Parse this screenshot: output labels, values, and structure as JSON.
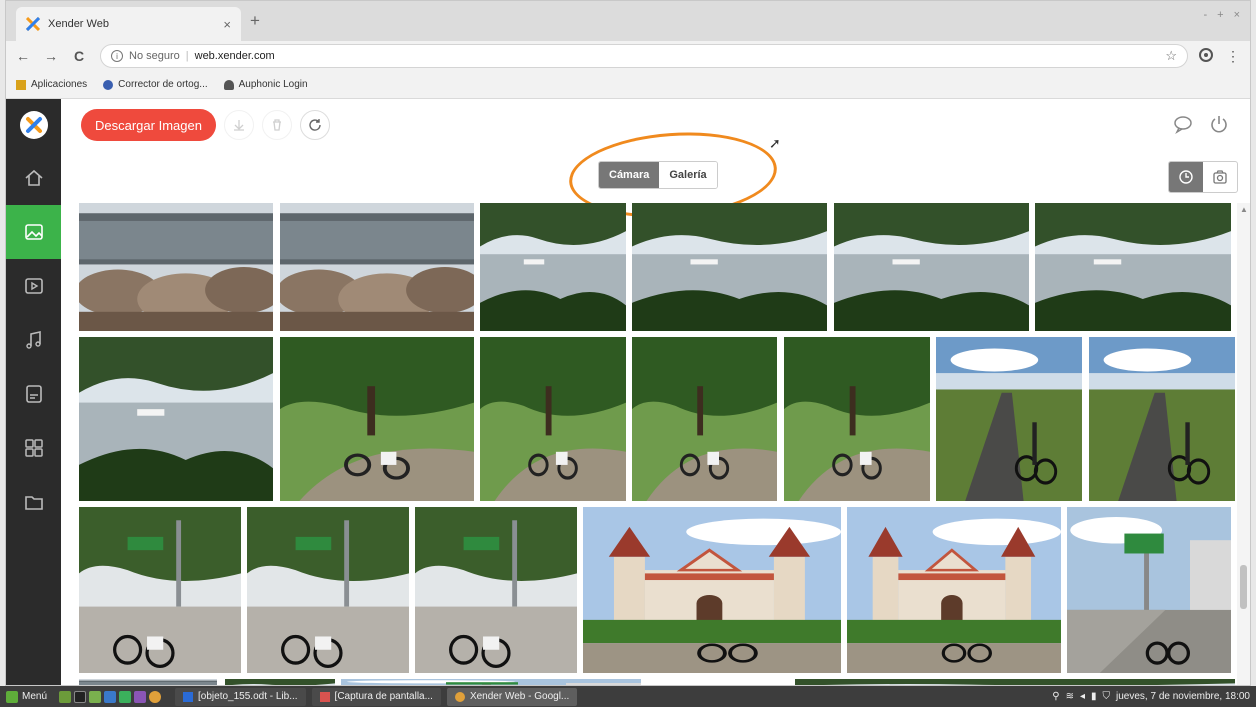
{
  "browser": {
    "tab_title": "Xender Web",
    "tab_close": "×",
    "new_tab": "+",
    "window_controls": [
      "-",
      "+",
      "×"
    ],
    "nav": {
      "back": "←",
      "forward": "→",
      "reload": "C"
    },
    "omnibox": {
      "security": "No seguro",
      "separator": "|",
      "url": "web.xender.com",
      "star": "☆"
    },
    "menu": "⋮",
    "bookmarks": [
      {
        "label": "Aplicaciones",
        "icon": "apps-grid-icon",
        "color": "#d9a21b"
      },
      {
        "label": "Corrector de ortog...",
        "icon": "spellcheck-icon",
        "color": "#3a5fb0"
      },
      {
        "label": "Auphonic Login",
        "icon": "auphonic-icon",
        "color": "#555555"
      }
    ]
  },
  "app": {
    "download_label": "Descargar Imagen",
    "tabs": [
      {
        "label": "Cámara",
        "active": true
      },
      {
        "label": "Galería",
        "active": false
      }
    ],
    "sidebar": [
      {
        "icon": "home-icon",
        "active": false
      },
      {
        "icon": "image-icon",
        "active": true
      },
      {
        "icon": "video-icon",
        "active": false
      },
      {
        "icon": "music-icon",
        "active": false
      },
      {
        "icon": "document-icon",
        "active": false
      },
      {
        "icon": "apps-icon",
        "active": false
      },
      {
        "icon": "folder-icon",
        "active": false
      }
    ],
    "colors": {
      "accent": "#3cb34a",
      "download": "#ef4a3d",
      "annotation": "#f08a1e",
      "sidebar": "#2b2b2b"
    },
    "photos": [
      {
        "type": "rocks"
      },
      {
        "type": "rocks"
      },
      {
        "type": "lake"
      },
      {
        "type": "lake"
      },
      {
        "type": "lake"
      },
      {
        "type": "lake"
      },
      {
        "type": "lake"
      },
      {
        "type": "orchard"
      },
      {
        "type": "orchard"
      },
      {
        "type": "orchard"
      },
      {
        "type": "orchard"
      },
      {
        "type": "road"
      },
      {
        "type": "road"
      },
      {
        "type": "sign"
      },
      {
        "type": "sign"
      },
      {
        "type": "sign"
      },
      {
        "type": "church"
      },
      {
        "type": "church"
      },
      {
        "type": "street"
      }
    ]
  },
  "taskbar": {
    "menu_label": "Menú",
    "tasks": [
      {
        "label": "[objeto_155.odt - Lib...",
        "color": "#2a6bd6",
        "active": false
      },
      {
        "label": "[Captura de pantalla...",
        "color": "#d9534f",
        "active": false
      },
      {
        "label": "Xender Web - Googl...",
        "color": "#e0a03a",
        "active": true
      }
    ],
    "clock": "jueves, 7 de noviembre, 18:00"
  }
}
